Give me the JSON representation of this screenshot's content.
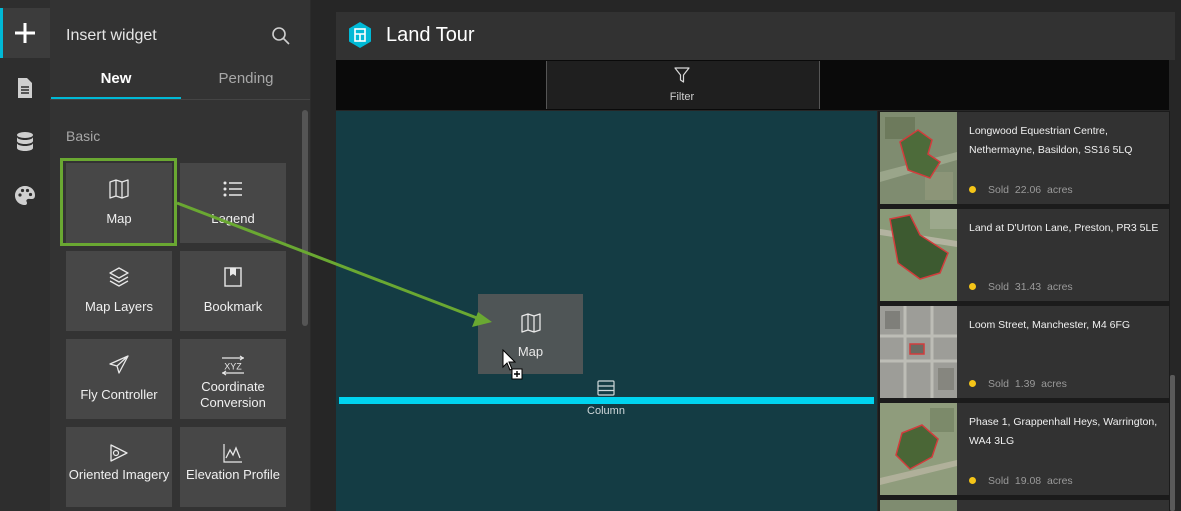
{
  "rail": {
    "items": [
      "add-icon",
      "page-icon",
      "data-icon",
      "theme-icon"
    ]
  },
  "panel": {
    "title": "Insert widget",
    "tabs": [
      {
        "label": "New"
      },
      {
        "label": "Pending"
      }
    ],
    "section": "Basic",
    "widgets": [
      {
        "label": "Map"
      },
      {
        "label": "Legend"
      },
      {
        "label": "Map Layers"
      },
      {
        "label": "Bookmark"
      },
      {
        "label": "Fly Controller"
      },
      {
        "label": "Coordinate Conversion"
      },
      {
        "label": "Oriented Imagery"
      },
      {
        "label": "Elevation Profile"
      }
    ]
  },
  "app": {
    "title": "Land Tour"
  },
  "toolbar": {
    "filter_label": "Filter"
  },
  "canvas": {
    "column_label": "Column",
    "drag_ghost_label": "Map"
  },
  "list": {
    "items": [
      {
        "title": "Longwood Equestrian Centre, Nethermayne, Basildon, SS16 5LQ",
        "status": "Sold",
        "size": "22.06",
        "unit": "acres"
      },
      {
        "title": "Land at D'Urton Lane, Preston, PR3 5LE",
        "status": "Sold",
        "size": "31.43",
        "unit": "acres"
      },
      {
        "title": "Loom Street, Manchester, M4 6FG",
        "status": "Sold",
        "size": "1.39",
        "unit": "acres"
      },
      {
        "title": "Phase 1, Grappenhall Heys, Warrington, WA4 3LG",
        "status": "Sold",
        "size": "19.08",
        "unit": "acres"
      }
    ]
  },
  "colors": {
    "accent": "#00b9d6",
    "highlight": "#6aa832",
    "status_dot": "#f5c518"
  }
}
